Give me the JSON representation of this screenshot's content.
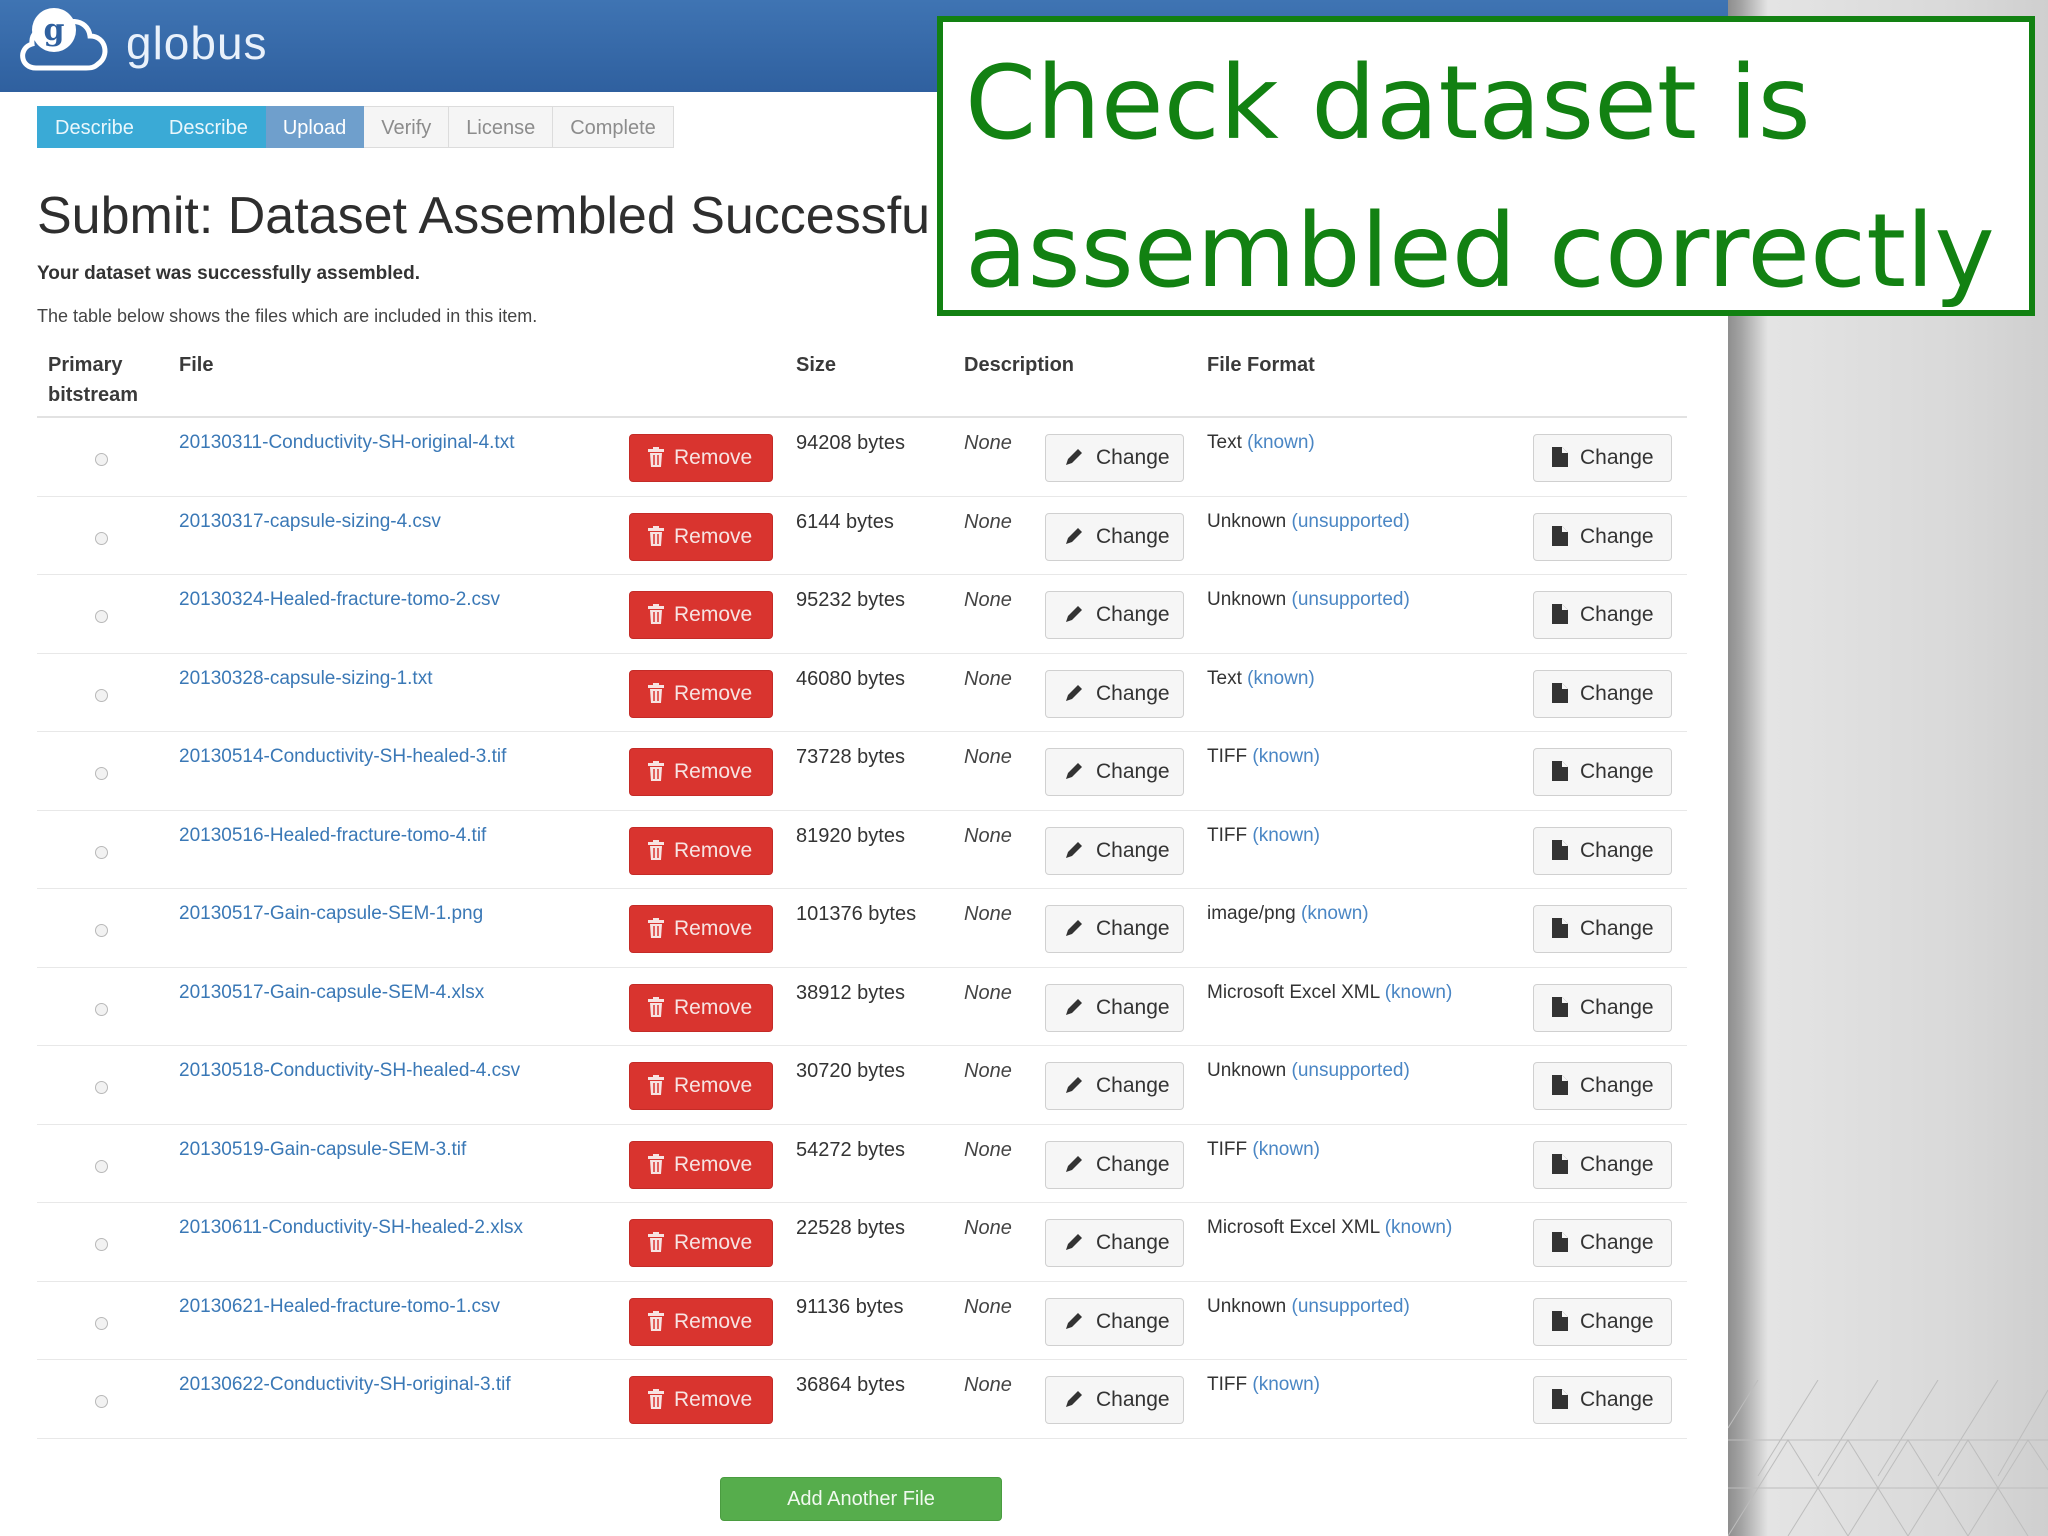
{
  "header": {
    "brand": "globus"
  },
  "steps": [
    {
      "label": "Describe",
      "state": "done"
    },
    {
      "label": "Describe",
      "state": "done"
    },
    {
      "label": "Upload",
      "state": "current"
    },
    {
      "label": "Verify",
      "state": "pending"
    },
    {
      "label": "License",
      "state": "pending"
    },
    {
      "label": "Complete",
      "state": "pending"
    }
  ],
  "page": {
    "title": "Submit: Dataset Assembled Successfu",
    "success": "Your dataset was successfully assembled.",
    "note": "The table below shows the files which are included in this item."
  },
  "callout": {
    "line1": "Check dataset is",
    "line2": "assembled correctly"
  },
  "table": {
    "headers": {
      "primary_line1": "Primary",
      "primary_line2": "bitstream",
      "file": "File",
      "size": "Size",
      "description": "Description",
      "format": "File Format"
    },
    "remove_label": "Remove",
    "change_label": "Change",
    "rows": [
      {
        "file": "20130311-Conductivity-SH-original-4.txt",
        "size": "94208 bytes",
        "desc": "None",
        "format": "Text",
        "support": "(known)"
      },
      {
        "file": "20130317-capsule-sizing-4.csv",
        "size": "6144 bytes",
        "desc": "None",
        "format": "Unknown",
        "support": "(unsupported)"
      },
      {
        "file": "20130324-Healed-fracture-tomo-2.csv",
        "size": "95232 bytes",
        "desc": "None",
        "format": "Unknown",
        "support": "(unsupported)"
      },
      {
        "file": "20130328-capsule-sizing-1.txt",
        "size": "46080 bytes",
        "desc": "None",
        "format": "Text",
        "support": "(known)"
      },
      {
        "file": "20130514-Conductivity-SH-healed-3.tif",
        "size": "73728 bytes",
        "desc": "None",
        "format": "TIFF",
        "support": "(known)"
      },
      {
        "file": "20130516-Healed-fracture-tomo-4.tif",
        "size": "81920 bytes",
        "desc": "None",
        "format": "TIFF",
        "support": "(known)"
      },
      {
        "file": "20130517-Gain-capsule-SEM-1.png",
        "size": "101376 bytes",
        "desc": "None",
        "format": "image/png",
        "support": "(known)"
      },
      {
        "file": "20130517-Gain-capsule-SEM-4.xlsx",
        "size": "38912 bytes",
        "desc": "None",
        "format": "Microsoft Excel XML",
        "support": "(known)"
      },
      {
        "file": "20130518-Conductivity-SH-healed-4.csv",
        "size": "30720 bytes",
        "desc": "None",
        "format": "Unknown",
        "support": "(unsupported)"
      },
      {
        "file": "20130519-Gain-capsule-SEM-3.tif",
        "size": "54272 bytes",
        "desc": "None",
        "format": "TIFF",
        "support": "(known)"
      },
      {
        "file": "20130611-Conductivity-SH-healed-2.xlsx",
        "size": "22528 bytes",
        "desc": "None",
        "format": "Microsoft Excel XML",
        "support": "(known)"
      },
      {
        "file": "20130621-Healed-fracture-tomo-1.csv",
        "size": "91136 bytes",
        "desc": "None",
        "format": "Unknown",
        "support": "(unsupported)"
      },
      {
        "file": "20130622-Conductivity-SH-original-3.tif",
        "size": "36864 bytes",
        "desc": "None",
        "format": "TIFF",
        "support": "(known)"
      }
    ]
  },
  "actions": {
    "add_file": "Add Another File"
  },
  "colors": {
    "header": "#3f74b3",
    "step_done": "#3aaad6",
    "step_current": "#6f9fcc",
    "remove": "#d9342f",
    "add": "#56ad4c",
    "callout": "#128112",
    "link": "#3a78b6"
  }
}
